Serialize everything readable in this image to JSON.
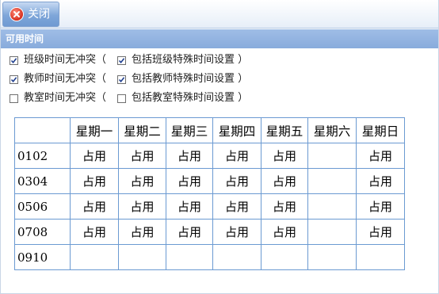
{
  "toolbar": {
    "close_label": "关闭"
  },
  "section": {
    "title": "可用时间"
  },
  "options": [
    {
      "label": "班级时间无冲突（",
      "checked": true
    },
    {
      "label": "包括班级特殊时间设置 ）",
      "checked": true
    },
    {
      "label": "教师时间无冲突（",
      "checked": true
    },
    {
      "label": "包括教师特殊时间设置 ）",
      "checked": true
    },
    {
      "label": "教室时间无冲突（",
      "checked": false
    },
    {
      "label": "包括教室特殊时间设置 ）",
      "checked": false
    }
  ],
  "schedule": {
    "corner": "",
    "days": [
      "星期一",
      "星期二",
      "星期三",
      "星期四",
      "星期五",
      "星期六",
      "星期日"
    ],
    "rows": [
      {
        "period": "0102",
        "cells": [
          "占用",
          "占用",
          "占用",
          "占用",
          "占用",
          "",
          "占用"
        ]
      },
      {
        "period": "0304",
        "cells": [
          "占用",
          "占用",
          "占用",
          "占用",
          "占用",
          "",
          "占用"
        ]
      },
      {
        "period": "0506",
        "cells": [
          "占用",
          "占用",
          "占用",
          "占用",
          "占用",
          "",
          "占用"
        ]
      },
      {
        "period": "0708",
        "cells": [
          "占用",
          "占用",
          "占用",
          "占用",
          "占用",
          "",
          "占用"
        ]
      },
      {
        "period": "0910",
        "cells": [
          "",
          "",
          "",
          "",
          "",
          "",
          ""
        ]
      }
    ]
  },
  "colors": {
    "header_bg": "#93b4e1",
    "grid_border": "#6b9ad2",
    "close_icon": "#d7301f"
  }
}
